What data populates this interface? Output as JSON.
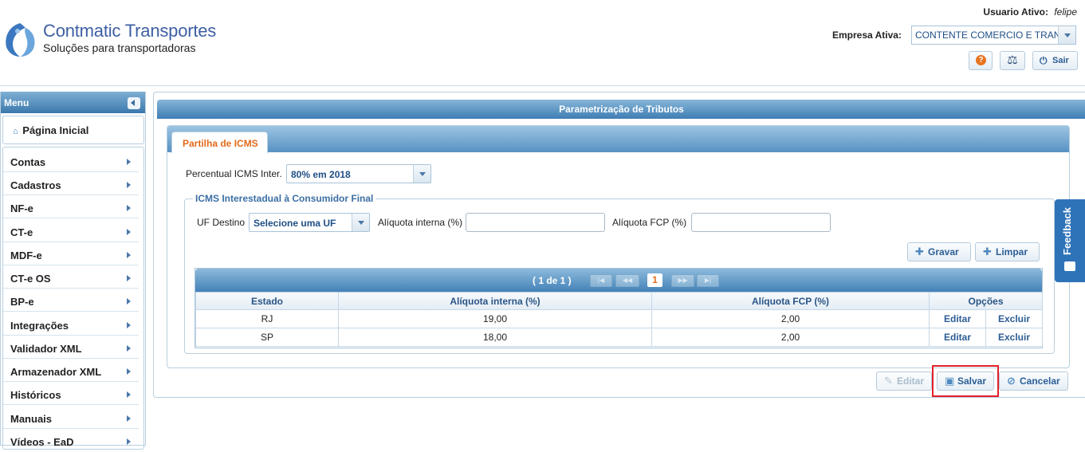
{
  "header": {
    "brand_name": "Contmatic Transportes",
    "brand_tagline": "Soluções para transportadoras",
    "user_label": "Usuario Ativo:",
    "user_name": "felipe",
    "company_label": "Empresa Ativa:",
    "company_value": "CONTENTE COMERCIO E TRANSPORTES",
    "help_label": "?",
    "exit_label": "Sair",
    "icons": {
      "help": "help-circle-icon",
      "scale": "balance-scale-icon",
      "exit": "power-icon"
    }
  },
  "sidebar": {
    "title": "Menu",
    "home_label": "Página Inicial",
    "items": [
      {
        "label": "Contas"
      },
      {
        "label": "Cadastros"
      },
      {
        "label": "NF-e"
      },
      {
        "label": "CT-e"
      },
      {
        "label": "MDF-e"
      },
      {
        "label": "CT-e OS"
      },
      {
        "label": "BP-e"
      },
      {
        "label": "Integrações"
      },
      {
        "label": "Validador XML"
      },
      {
        "label": "Armazenador XML"
      },
      {
        "label": "Históricos"
      },
      {
        "label": "Manuais"
      },
      {
        "label": "Vídeos - EaD"
      }
    ]
  },
  "main": {
    "title": "Parametrização de Tributos",
    "tab_label": "Partilha de ICMS",
    "percentual_label": "Percentual ICMS Inter.",
    "percentual_value": "80% em 2018",
    "fieldset_legend": "ICMS Interestadual à Consumidor Final",
    "uf_label": "UF Destino",
    "uf_value": "Selecione uma UF",
    "aliquota_interna_label": "Alíquota interna (%)",
    "aliquota_interna_value": "",
    "aliquota_fcp_label": "Alíquota FCP (%)",
    "aliquota_fcp_value": "",
    "gravar_label": "Gravar",
    "limpar_label": "Limpar"
  },
  "grid": {
    "pager_info": "( 1 de 1 )",
    "current_page": "1",
    "columns": [
      "Estado",
      "Alíquota interna (%)",
      "Alíquota FCP (%)",
      "Opções"
    ],
    "rows": [
      {
        "estado": "RJ",
        "interna": "19,00",
        "fcp": "2,00",
        "edit": "Editar",
        "delete": "Excluir"
      },
      {
        "estado": "SP",
        "interna": "18,00",
        "fcp": "2,00",
        "edit": "Editar",
        "delete": "Excluir"
      }
    ]
  },
  "actions": {
    "editar_label": "Editar",
    "salvar_label": "Salvar",
    "cancelar_label": "Cancelar"
  },
  "feedback_label": "Feedback",
  "colors": {
    "brand": "#3d5fa3",
    "accent": "#e26a1a",
    "header_bar": "#3f7db3",
    "highlight": "#e2202a",
    "feedback": "#2e73b8"
  }
}
